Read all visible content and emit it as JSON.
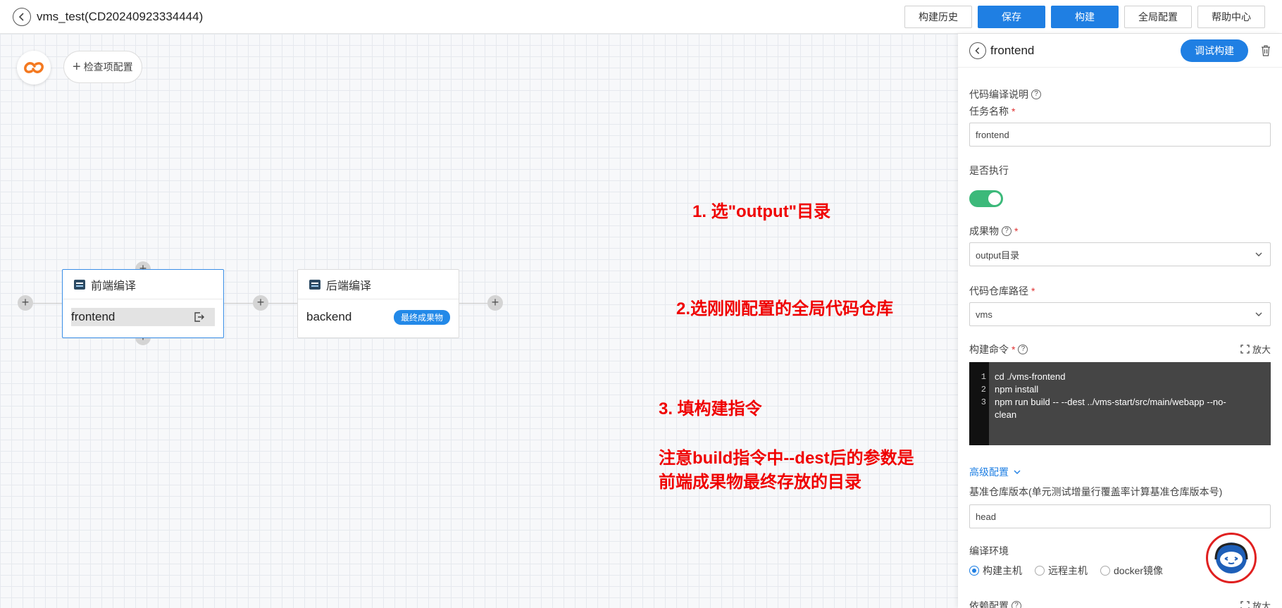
{
  "header": {
    "title": "vms_test(CD20240923334444)",
    "buttons": [
      "构建历史",
      "保存",
      "构建",
      "全局配置",
      "帮助中心"
    ]
  },
  "canvas": {
    "check_config_label": "检查项配置",
    "stages": [
      {
        "title": "前端编译",
        "job": "frontend"
      },
      {
        "title": "后端编译",
        "job": "backend",
        "badge": "最终成果物"
      }
    ],
    "annotations": [
      "1. 选\"output\"目录",
      "2.选刚刚配置的全局代码仓库",
      "3. 填构建指令",
      "注意build指令中--dest后的参数是",
      "前端成果物最终存放的目录"
    ]
  },
  "panel": {
    "title": "frontend",
    "debug_label": "调试构建",
    "desc_label": "代码编译说明",
    "task_name_label": "任务名称",
    "task_name_value": "frontend",
    "execute_label": "是否执行",
    "execute_on": true,
    "artifact_label": "成果物",
    "artifact_value": "output目录",
    "repo_path_label": "代码仓库路径",
    "repo_path_value": "vms",
    "command_label": "构建命令",
    "zoom_label": "放大",
    "code": {
      "line_numbers": [
        "1",
        "2",
        "3"
      ],
      "lines": [
        "cd ./vms-frontend",
        "npm install",
        "npm run build -- --dest ../vms-start/src/main/webapp  --no-",
        "clean"
      ]
    },
    "advanced_label": "高级配置",
    "baseline_label": "基准仓库版本(单元测试增量行覆盖率计算基准仓库版本号)",
    "baseline_value": "head",
    "env_label": "编译环境",
    "env_options": [
      "构建主机",
      "远程主机",
      "docker镜像"
    ],
    "env_selected": "构建主机",
    "deps_label": "依赖配置",
    "deps_zoom_label": "放大"
  },
  "colors": {
    "primary": "#1f7fe3",
    "toggle_on": "#3cb97a",
    "annotation": "#f00000"
  }
}
